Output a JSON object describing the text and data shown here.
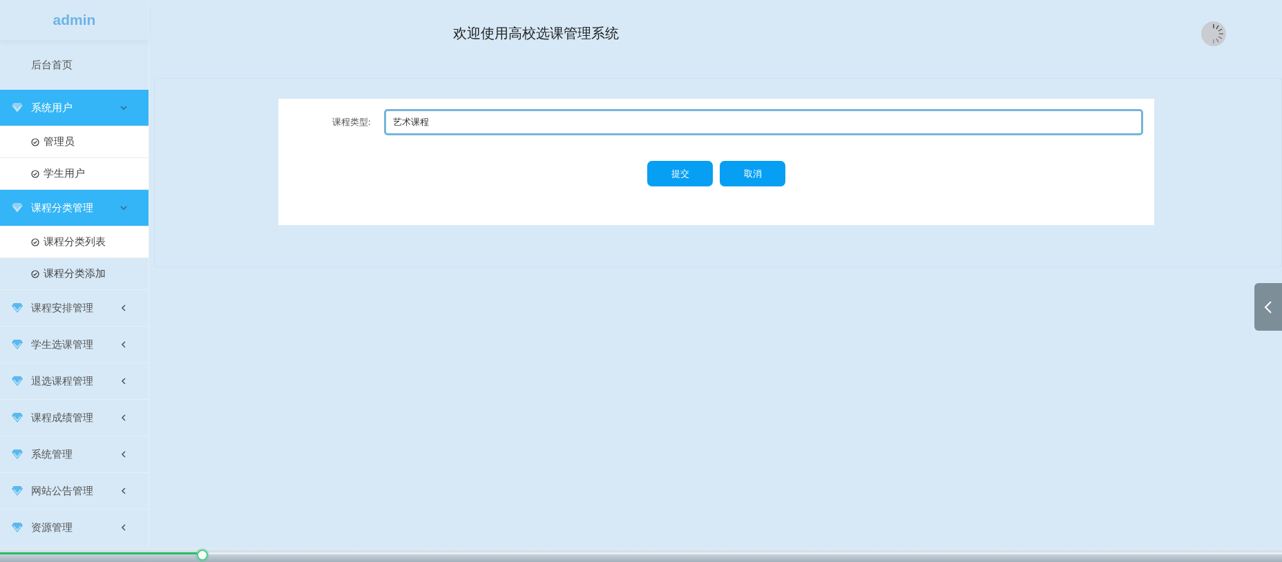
{
  "sidebar": {
    "logo": "admin",
    "items": [
      {
        "kind": "link",
        "label": "后台首页"
      },
      {
        "kind": "group",
        "label": "系统用户",
        "expanded": true,
        "children": [
          {
            "label": "管理员",
            "selected": false
          },
          {
            "label": "学生用户",
            "selected": false
          }
        ]
      },
      {
        "kind": "group",
        "label": "课程分类管理",
        "expanded": true,
        "children": [
          {
            "label": "课程分类列表",
            "selected": false
          },
          {
            "label": "课程分类添加",
            "selected": true
          }
        ]
      },
      {
        "kind": "group",
        "label": "课程安排管理",
        "expanded": false
      },
      {
        "kind": "group",
        "label": "学生选课管理",
        "expanded": false
      },
      {
        "kind": "group",
        "label": "退选课程管理",
        "expanded": false
      },
      {
        "kind": "group",
        "label": "课程成绩管理",
        "expanded": false
      },
      {
        "kind": "group",
        "label": "系统管理",
        "expanded": false
      },
      {
        "kind": "group",
        "label": "网站公告管理",
        "expanded": false
      },
      {
        "kind": "group",
        "label": "资源管理",
        "expanded": false
      }
    ]
  },
  "header": {
    "title": "欢迎使用高校选课管理系统"
  },
  "form": {
    "fields": [
      {
        "label": "课程类型:",
        "value": "艺术课程"
      }
    ],
    "buttons": [
      "提交",
      "取消"
    ]
  },
  "player_bar": {
    "level": 0.158
  }
}
